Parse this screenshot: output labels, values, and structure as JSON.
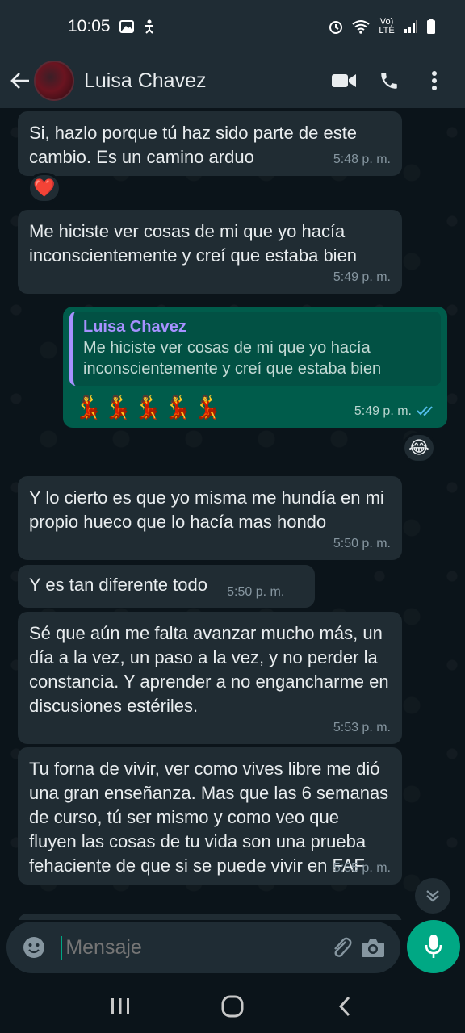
{
  "status_bar": {
    "time": "10:05",
    "network": "Vo) LTE"
  },
  "header": {
    "contact_name": "Luisa Chavez"
  },
  "messages": [
    {
      "text": "Si, hazlo porque tú haz sido parte de este cambio. Es un camino arduo",
      "time": "5:48 p. m.",
      "reaction": "❤️"
    },
    {
      "text": "Me hiciste ver cosas de mi que yo hacía inconscientemente y creí que estaba bien",
      "time": "5:49 p. m."
    },
    {
      "quote_author": "Luisa Chavez",
      "quote_text": "Me hiciste ver cosas de mi que yo hacía inconscientemente y creí que estaba bien",
      "text": "💃💃💃💃💃",
      "time": "5:49 p. m.",
      "reaction": "😂"
    },
    {
      "text": "Y lo cierto es que yo misma me hundía en mi propio hueco que lo hacía mas hondo",
      "time": "5:50 p. m."
    },
    {
      "text": "Y es tan diferente todo",
      "time": "5:50 p. m."
    },
    {
      "text": "Sé que aún me falta avanzar mucho más, un día a la vez, un paso a la vez, y no perder la constancia. Y aprender a no engancharme en discusiones estériles.",
      "time": "5:53 p. m."
    },
    {
      "text": "Tu forna de vivir, ver como vives libre me dió una gran enseñanza. Mas que las 6 semanas de curso, tú ser mismo y como veo que fluyen las cosas de tu vida son una prueba fehaciente de que si se puede vivir en FAF",
      "time": "5:55 p. m."
    }
  ],
  "composer": {
    "placeholder": "Mensaje"
  },
  "colors": {
    "accent": "#00a884",
    "incoming": "#202c33",
    "outgoing": "#005c4b",
    "quote_name": "#a791ff"
  }
}
